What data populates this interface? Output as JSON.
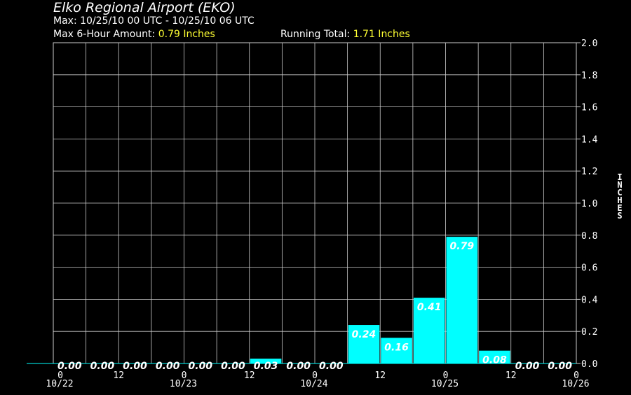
{
  "header": {
    "title": "Elko Regional Airport (EKO)",
    "max_line": "Max: 10/25/10 00 UTC - 10/25/10 06 UTC",
    "max_amount_label": "Max 6-Hour Amount: ",
    "max_amount_value": "0.79 Inches",
    "running_total_label": "Running Total: ",
    "running_total_value": "1.71 Inches"
  },
  "chart_data": {
    "type": "bar",
    "title": "Elko Regional Airport (EKO)",
    "ylabel": "INCHES",
    "ylim": [
      0,
      2.0
    ],
    "yticks": [
      "0.0",
      "0.2",
      "0.4",
      "0.6",
      "0.8",
      "1.0",
      "1.2",
      "1.4",
      "1.6",
      "1.8",
      "2.0"
    ],
    "xticks": [
      "0",
      "12",
      "0",
      "12",
      "0",
      "12",
      "0",
      "12",
      "0"
    ],
    "xdates": [
      "10/22",
      "",
      "10/23",
      "",
      "10/24",
      "",
      "10/25",
      "",
      "10/26"
    ],
    "values": [
      0.0,
      0.0,
      0.0,
      0.0,
      0.0,
      0.0,
      0.03,
      0.0,
      0.0,
      0.24,
      0.16,
      0.41,
      0.79,
      0.08,
      0.0,
      0.0
    ],
    "labels": [
      "0.00",
      "0.00",
      "0.00",
      "0.00",
      "0.00",
      "0.00",
      "0.03",
      "0.00",
      "0.00",
      "0.24",
      "0.16",
      "0.41",
      "0.79",
      "0.08",
      "0.00",
      "0.00"
    ],
    "grid": true,
    "colors": {
      "bar": "#00ffff",
      "grid": "#cccccc",
      "background": "#000000",
      "label": "#ffffff"
    }
  }
}
